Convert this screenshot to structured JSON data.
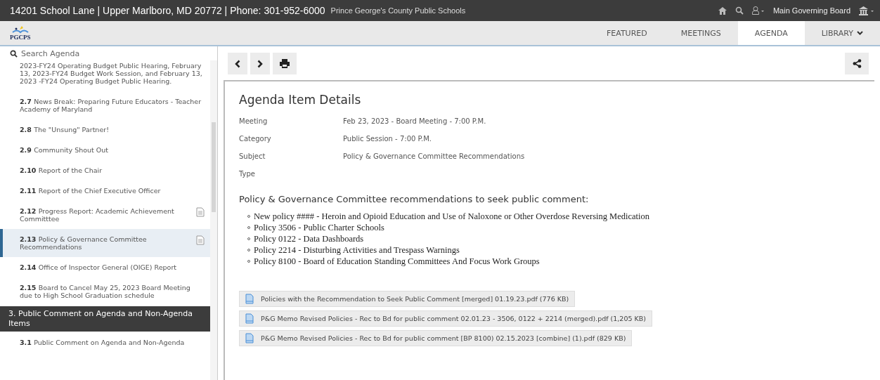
{
  "top_bar": {
    "address": "14201 School Lane | Upper Marlboro, MD 20772 | Phone: 301-952-6000",
    "org": "Prince George's County Public Schools",
    "board": "Main Governing Board"
  },
  "nav": {
    "logo": "PGCPS",
    "tabs": [
      {
        "label": "FEATURED",
        "selected": false
      },
      {
        "label": "MEETINGS",
        "selected": false
      },
      {
        "label": "AGENDA",
        "selected": true
      },
      {
        "label": "LIBRARY",
        "selected": false,
        "dropdown": true
      }
    ]
  },
  "sidebar": {
    "search": {
      "placeholder": "Search Agenda"
    },
    "items": [
      {
        "kind": "item",
        "title": "2023-FY24 Operating Budget Public Hearing, February 13, 2023-FY24 Budget Work Session, and February 13, 2023 -FY24 Operating Budget Public Hearing.",
        "selected": false,
        "has_document": false
      },
      {
        "kind": "item",
        "number": "2.7",
        "title": "News Break: Preparing Future Educators - Teacher Academy of Maryland",
        "selected": false,
        "has_document": false
      },
      {
        "kind": "item",
        "number": "2.8",
        "title": "The \"Unsung\" Partner!",
        "selected": false,
        "has_document": false
      },
      {
        "kind": "item",
        "number": "2.9",
        "title": "Community Shout Out",
        "selected": false,
        "has_document": false
      },
      {
        "kind": "item",
        "number": "2.10",
        "title": "Report of the Chair",
        "selected": false,
        "has_document": false
      },
      {
        "kind": "item",
        "number": "2.11",
        "title": "Report of the Chief Executive Officer",
        "selected": false,
        "has_document": false
      },
      {
        "kind": "item",
        "number": "2.12",
        "title": "Progress Report: Academic Achievement Committtee",
        "selected": false,
        "has_document": true
      },
      {
        "kind": "item",
        "number": "2.13",
        "title": "Policy & Governance Committee Recommendations",
        "selected": true,
        "has_document": true
      },
      {
        "kind": "item",
        "number": "2.14",
        "title": "Office of Inspector General (OIGE) Report",
        "selected": false,
        "has_document": false
      },
      {
        "kind": "item",
        "number": "2.15",
        "title": "Board to Cancel May 25, 2023 Board Meeting due to High School Graduation schedule",
        "selected": false,
        "has_document": false
      },
      {
        "kind": "section",
        "title": "3. Public Comment on Agenda and Non-Agenda Items"
      },
      {
        "kind": "item",
        "number": "3.1",
        "title": "Public Comment on Agenda and Non-Agenda",
        "selected": false,
        "has_document": false
      }
    ]
  },
  "details": {
    "title": "Agenda Item Details",
    "fields": [
      {
        "label": "Meeting",
        "value": "Feb 23, 2023 - Board Meeting - 7:00 P.M."
      },
      {
        "label": "Category",
        "value": "Public Session - 7:00 P.M."
      },
      {
        "label": "Subject",
        "value": "Policy & Governance Committee Recommendations"
      },
      {
        "label": "Type"
      }
    ],
    "heading": "Policy & Governance Committee recommendations to seek public comment:",
    "bullets": [
      "New policy #### - Heroin and Opioid Education and Use of Naloxone or Other Overdose Reversing Medication",
      "Policy 3506 - Public Charter Schools",
      "Policy 0122 - Data Dashboards",
      "Policy 2214 - Disturbing Activities and Trespass Warnings",
      "Policy 8100 - Board of Education Standing Committees And Focus Work Groups"
    ],
    "attachments": [
      "Policies with the Recommendation to Seek Public Comment [merged] 01.19.23.pdf (776 KB)",
      "P&G Memo Revised Policies - Rec to Bd for public comment 02.01.23 - 3506, 0122 + 2214 (merged).pdf (1,205 KB)",
      "P&G Memo Revised Policies - Rec to Bd for public comment [BP 8100) 02.15.2023 [combine] (1).pdf (829 KB)"
    ]
  }
}
